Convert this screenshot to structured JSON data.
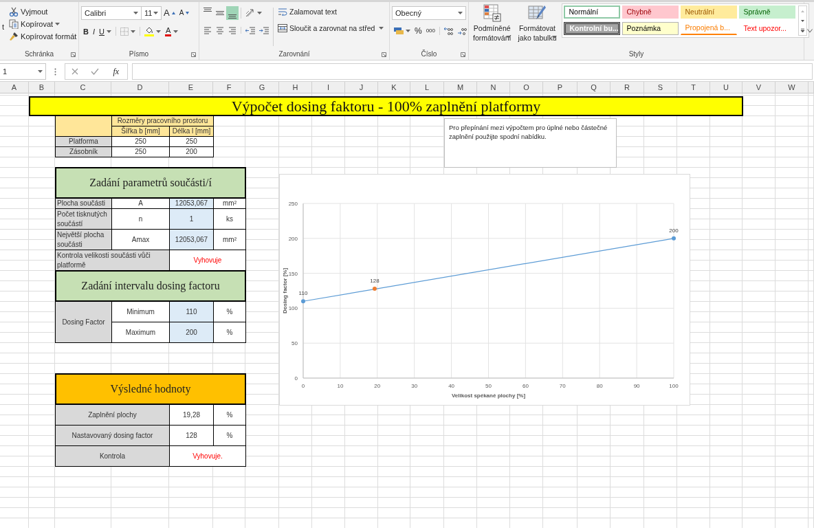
{
  "ribbon": {
    "clipboard": {
      "paste_label": "t",
      "items": [
        {
          "kind": "cut",
          "label": "Vyjmout",
          "has_menu": false
        },
        {
          "kind": "copy",
          "label": "Kopírovat",
          "has_menu": true
        },
        {
          "kind": "format_painter",
          "label": "Kopírovat formát",
          "has_menu": false
        }
      ],
      "group_label": "Schránka"
    },
    "font": {
      "name": "Calibri",
      "size": "11",
      "grow": "A",
      "shrink": "A",
      "bold": "B",
      "italic": "I",
      "underline": "U",
      "font_color": "A",
      "group_label": "Písmo"
    },
    "alignment": {
      "vertical": [
        {
          "kind": "top",
          "selected": false
        },
        {
          "kind": "middle",
          "selected": false
        },
        {
          "kind": "bottom",
          "selected": true
        }
      ],
      "horizontal": [
        {
          "kind": "left",
          "selected": false
        },
        {
          "kind": "center",
          "selected": false
        },
        {
          "kind": "right",
          "selected": false
        }
      ],
      "wrap_text": "Zalamovat text",
      "merge": "Sloučit a zarovnat na střed",
      "group_label": "Zarovnání"
    },
    "number": {
      "format": "Obecný",
      "percent": "%",
      "thousands": "000",
      "group_label": "Číslo"
    },
    "styles": {
      "conditional_formatting": [
        "Podmíněné",
        "formátování"
      ],
      "format_as_table": [
        "Formátovat",
        "jako tabulku"
      ],
      "cells": [
        {
          "label": "Normální",
          "kind": "normal",
          "selected": true
        },
        {
          "label": "Chybně",
          "kind": "bad",
          "selected": false
        },
        {
          "label": "Neutrální",
          "kind": "neutral",
          "selected": false
        },
        {
          "label": "Správně",
          "kind": "good",
          "selected": false
        },
        {
          "label": "Kontrolní bu...",
          "kind": "check",
          "selected": false
        },
        {
          "label": "Poznámka",
          "kind": "note",
          "selected": false
        },
        {
          "label": "Propojená b...",
          "kind": "linked",
          "selected": false
        },
        {
          "label": "Text upozor...",
          "kind": "warning",
          "selected": false
        }
      ],
      "group_label": "Styly"
    }
  },
  "formula_bar": {
    "name_box": "1",
    "function_label": "fx"
  },
  "columns": [
    "A",
    "B",
    "C",
    "D",
    "E",
    "F",
    "G",
    "H",
    "I",
    "J",
    "K",
    "L",
    "M",
    "N",
    "O",
    "P",
    "Q",
    "R",
    "S",
    "T",
    "U",
    "V",
    "W"
  ],
  "sheet": {
    "title": "Výpočet dosing faktoru - 100% zaplnění platformy",
    "dimensions": {
      "header": "Rozměry pracovního prostoru",
      "columns": [
        "Šířka b [mm]",
        "Délka l [mm]"
      ],
      "rows": [
        {
          "label": "Platforma",
          "values": [
            "250",
            "250"
          ]
        },
        {
          "label": "Zásobník",
          "values": [
            "250",
            "200"
          ]
        }
      ]
    },
    "part_parameters": {
      "title": "Zadání parametrů součásti/í",
      "rows": [
        {
          "label": "Plocha součásti",
          "symbol": "A",
          "value": "12053,067",
          "unit": "mm²"
        },
        {
          "label": "Počet tisknutých součástí",
          "symbol": "n",
          "value": "1",
          "unit": "ks"
        },
        {
          "label": "Největší plocha součásti",
          "symbol": "Amax",
          "value": "12053,067",
          "unit": "mm²"
        }
      ],
      "check": {
        "label": "Kontrola velikosti součásti vůči platformě",
        "result": "Vyhovuje"
      }
    },
    "dosing_interval": {
      "title": "Zadání intervalu dosing factoru",
      "label": "Dosing Factor",
      "rows": [
        {
          "name": "Minimum",
          "value": "110",
          "unit": "%"
        },
        {
          "name": "Maximum",
          "value": "200",
          "unit": "%"
        }
      ]
    },
    "results": {
      "title": "Výsledné hodnoty",
      "rows": [
        {
          "label": "Zaplnění plochy",
          "value": "19,28",
          "unit": "%"
        },
        {
          "label": "Nastavovaný dosing factor",
          "value": "128",
          "unit": "%"
        }
      ],
      "check": {
        "label": "Kontrola",
        "result": "Vyhovuje."
      }
    },
    "note": "Pro přepínání mezi výpočtem pro úplné nebo částečné zaplnění použijte spodní nabídku.",
    "chart": {
      "chart_data": {
        "type": "line",
        "xlabel": "Velikost spékané plochy [%]",
        "ylabel": "Dosing factor [%]",
        "x": [
          0,
          19.28,
          100
        ],
        "series": [
          {
            "color": "#5b9bd5",
            "marker": true,
            "values": [
              110,
              null,
              200
            ]
          },
          {
            "color": "#ed7d31",
            "marker": true,
            "values": [
              null,
              128,
              null
            ]
          }
        ],
        "grid": true,
        "xlim": [
          0,
          100
        ],
        "ylim": [
          0,
          250
        ],
        "xticks": [
          0,
          10,
          20,
          30,
          40,
          50,
          60,
          70,
          80,
          90,
          100
        ],
        "yticks": [
          0,
          50,
          100,
          150,
          200,
          250
        ],
        "data_labels": true
      }
    }
  }
}
